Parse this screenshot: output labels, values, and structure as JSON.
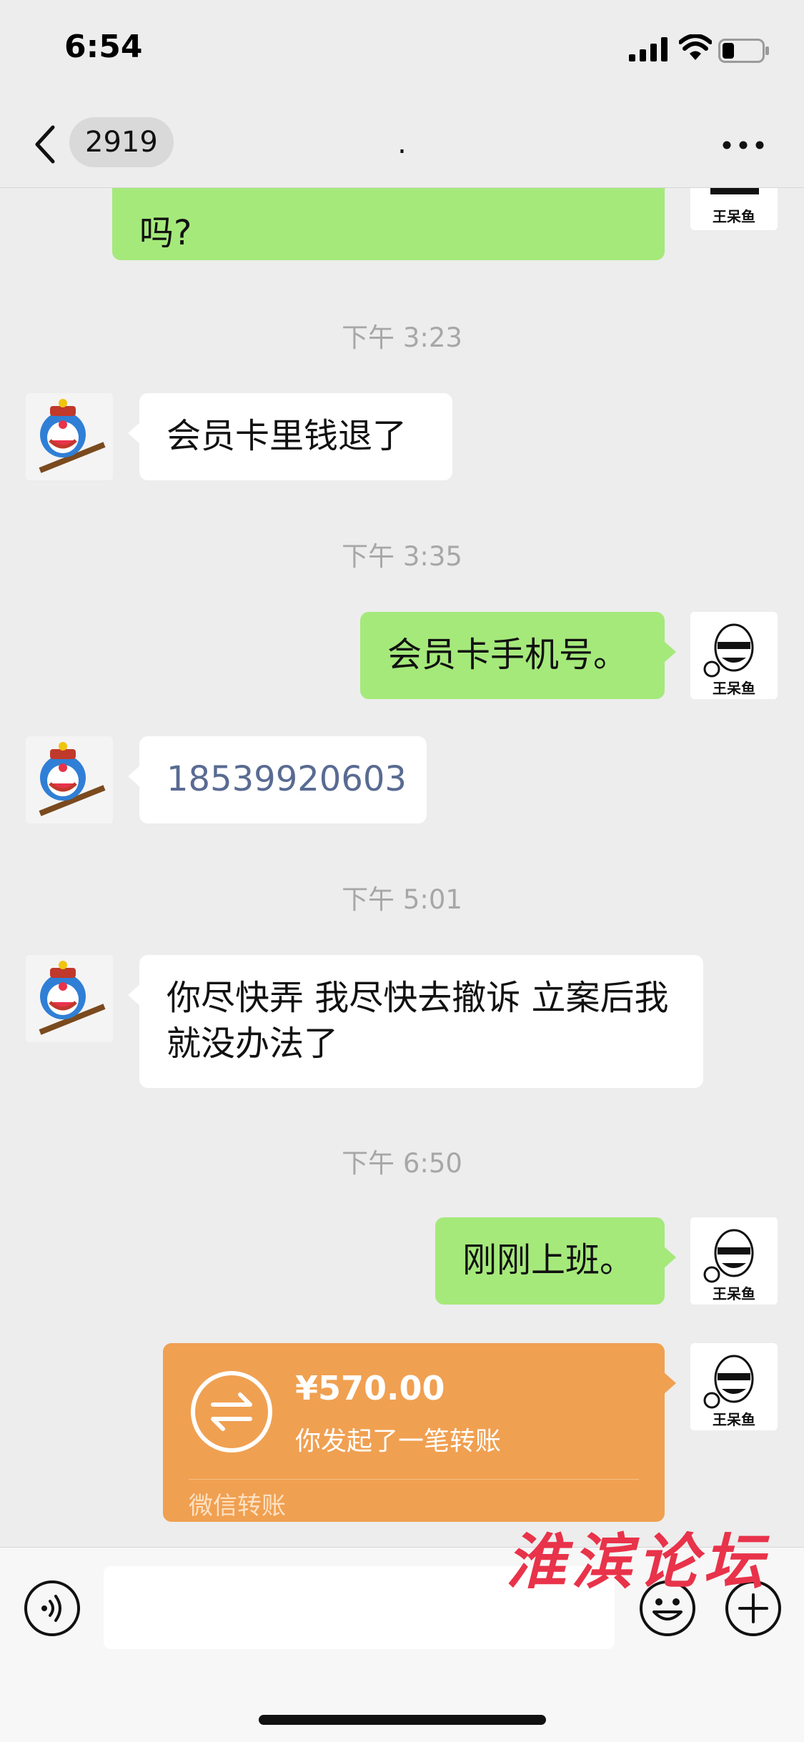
{
  "status_bar": {
    "time": "6:54"
  },
  "header": {
    "unread_count": "2919",
    "title": "."
  },
  "messages": {
    "m0": {
      "text": "吗?"
    },
    "t1": "下午 3:23",
    "m1": {
      "text": "会员卡里钱退了"
    },
    "t2": "下午 3:35",
    "m2": {
      "text": "会员卡手机号。"
    },
    "m3": {
      "text": "18539920603"
    },
    "t3": "下午 5:01",
    "m4": {
      "text": "你尽快弄 我尽快去撤诉  立案后我就没办法了"
    },
    "t4": "下午 6:50",
    "m5": {
      "text": "刚刚上班。"
    },
    "transfer": {
      "amount": "¥570.00",
      "description": "你发起了一笔转账",
      "footer": "微信转账"
    }
  },
  "avatars": {
    "self_label": "王呆鱼"
  },
  "watermark": "淮滨论坛",
  "colors": {
    "outgoing_bubble": "#a5e97b",
    "incoming_bubble": "#ffffff",
    "transfer_card": "#f0a051",
    "background": "#ededed"
  },
  "icons": [
    "back-icon",
    "more-icon",
    "voice-icon",
    "emoji-icon",
    "plus-icon",
    "transfer-arrows-icon"
  ]
}
